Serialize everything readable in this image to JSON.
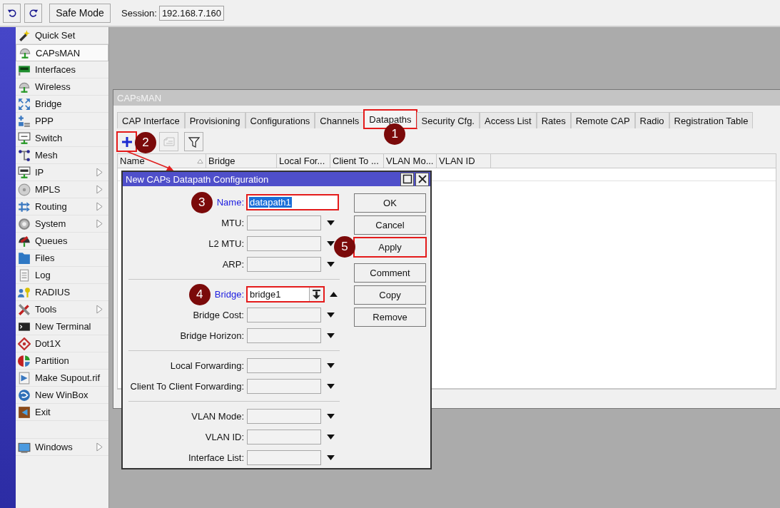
{
  "toolbar": {
    "safe_mode": {
      "label": "Safe Mode"
    },
    "session": {
      "label": "Session:",
      "value": "192.168.7.160"
    }
  },
  "menu": [
    {
      "label": "Quick Set",
      "submenu": false,
      "selected": false
    },
    {
      "label": "CAPsMAN",
      "submenu": false,
      "selected": true
    },
    {
      "label": "Interfaces",
      "submenu": false,
      "selected": false
    },
    {
      "label": "Wireless",
      "submenu": false,
      "selected": false
    },
    {
      "label": "Bridge",
      "submenu": false,
      "selected": false
    },
    {
      "label": "PPP",
      "submenu": false,
      "selected": false
    },
    {
      "label": "Switch",
      "submenu": false,
      "selected": false
    },
    {
      "label": "Mesh",
      "submenu": false,
      "selected": false
    },
    {
      "label": "IP",
      "submenu": true,
      "selected": false
    },
    {
      "label": "MPLS",
      "submenu": true,
      "selected": false
    },
    {
      "label": "Routing",
      "submenu": true,
      "selected": false
    },
    {
      "label": "System",
      "submenu": true,
      "selected": false
    },
    {
      "label": "Queues",
      "submenu": false,
      "selected": false
    },
    {
      "label": "Files",
      "submenu": false,
      "selected": false
    },
    {
      "label": "Log",
      "submenu": false,
      "selected": false
    },
    {
      "label": "RADIUS",
      "submenu": false,
      "selected": false
    },
    {
      "label": "Tools",
      "submenu": true,
      "selected": false
    },
    {
      "label": "New Terminal",
      "submenu": false,
      "selected": false
    },
    {
      "label": "Dot1X",
      "submenu": false,
      "selected": false
    },
    {
      "label": "Partition",
      "submenu": false,
      "selected": false
    },
    {
      "label": "Make Supout.rif",
      "submenu": false,
      "selected": false
    },
    {
      "label": "New WinBox",
      "submenu": false,
      "selected": false
    },
    {
      "label": "Exit",
      "submenu": false,
      "selected": false
    }
  ],
  "menu_bottom": [
    {
      "label": "Windows",
      "submenu": true,
      "selected": false
    }
  ],
  "capsman_window": {
    "title": "CAPsMAN",
    "tabs": [
      {
        "label": "CAP Interface",
        "selected": false
      },
      {
        "label": "Provisioning",
        "selected": false
      },
      {
        "label": "Configurations",
        "selected": false
      },
      {
        "label": "Channels",
        "selected": false
      },
      {
        "label": "Datapaths",
        "selected": true,
        "step": "1"
      },
      {
        "label": "Security Cfg.",
        "selected": false
      },
      {
        "label": "Access List",
        "selected": false
      },
      {
        "label": "Rates",
        "selected": false
      },
      {
        "label": "Remote CAP",
        "selected": false
      },
      {
        "label": "Radio",
        "selected": false
      },
      {
        "label": "Registration Table",
        "selected": false
      }
    ],
    "tool_buttons": [
      {
        "kind": "add",
        "step": "2",
        "disabled": false
      },
      {
        "kind": "comment",
        "disabled": true
      },
      {
        "kind": "filter",
        "disabled": false
      }
    ],
    "columns": [
      {
        "label": "Name",
        "sorted": true
      },
      {
        "label": "Bridge",
        "sorted": false
      },
      {
        "label": "Local For...",
        "sorted": false
      },
      {
        "label": "Client To ...",
        "sorted": false
      },
      {
        "label": "VLAN Mo...",
        "sorted": false
      },
      {
        "label": "VLAN ID",
        "sorted": false
      }
    ]
  },
  "dialog": {
    "title": "New CAPs Datapath Configuration",
    "groups": [
      [
        {
          "label": "Name:",
          "kind": "text",
          "required": true,
          "value": "datapath1",
          "step": "3"
        },
        {
          "label": "MTU:",
          "kind": "dropdown",
          "required": false
        },
        {
          "label": "L2 MTU:",
          "kind": "dropdown",
          "required": false
        },
        {
          "label": "ARP:",
          "kind": "dropdown",
          "required": false
        }
      ],
      [
        {
          "label": "Bridge:",
          "kind": "combo",
          "required": true,
          "value": "bridge1",
          "step": "4"
        },
        {
          "label": "Bridge Cost:",
          "kind": "dropdown",
          "required": false
        },
        {
          "label": "Bridge Horizon:",
          "kind": "dropdown",
          "required": false
        }
      ],
      [
        {
          "label": "Local Forwarding:",
          "kind": "dropdown",
          "required": false
        },
        {
          "label": "Client To Client Forwarding:",
          "kind": "dropdown",
          "required": false
        }
      ],
      [
        {
          "label": "VLAN Mode:",
          "kind": "dropdown",
          "required": false
        },
        {
          "label": "VLAN ID:",
          "kind": "dropdown",
          "required": false
        },
        {
          "label": "Interface List:",
          "kind": "dropdown",
          "required": false
        }
      ]
    ],
    "button_groups": [
      [
        {
          "label": "OK"
        },
        {
          "label": "Cancel"
        },
        {
          "label": "Apply",
          "step": "5"
        }
      ],
      [
        {
          "label": "Comment"
        },
        {
          "label": "Copy"
        },
        {
          "label": "Remove"
        }
      ]
    ]
  }
}
